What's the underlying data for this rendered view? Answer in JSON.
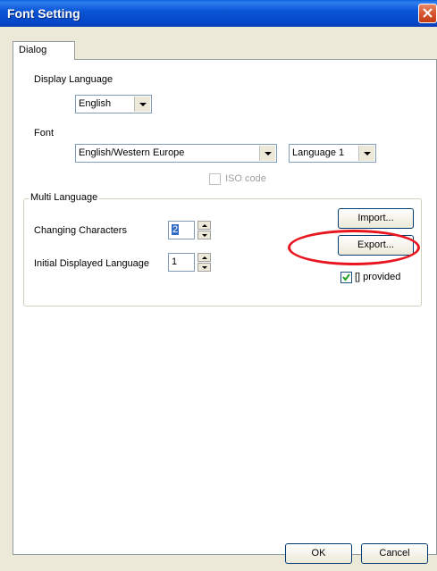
{
  "window": {
    "title": "Font Setting"
  },
  "tabs": [
    {
      "label": "Dialog"
    }
  ],
  "display_language": {
    "label": "Display Language",
    "value": "English"
  },
  "font": {
    "label": "Font",
    "value": "English/Western Europe",
    "language_value": "Language 1"
  },
  "iso_code": {
    "label": "ISO code",
    "checked": false,
    "enabled": false
  },
  "multi_language": {
    "title": "Multi Language",
    "changing_characters": {
      "label": "Changing Characters",
      "value": "2"
    },
    "initial_displayed_language": {
      "label": "Initial Displayed Language",
      "value": "1"
    },
    "import_label": "Import...",
    "export_label": "Export...",
    "provided": {
      "label": "[] provided",
      "checked": true
    }
  },
  "footer": {
    "ok_label": "OK",
    "cancel_label": "Cancel"
  },
  "annotation": {
    "color": "#e8141e",
    "target": "export-button"
  }
}
